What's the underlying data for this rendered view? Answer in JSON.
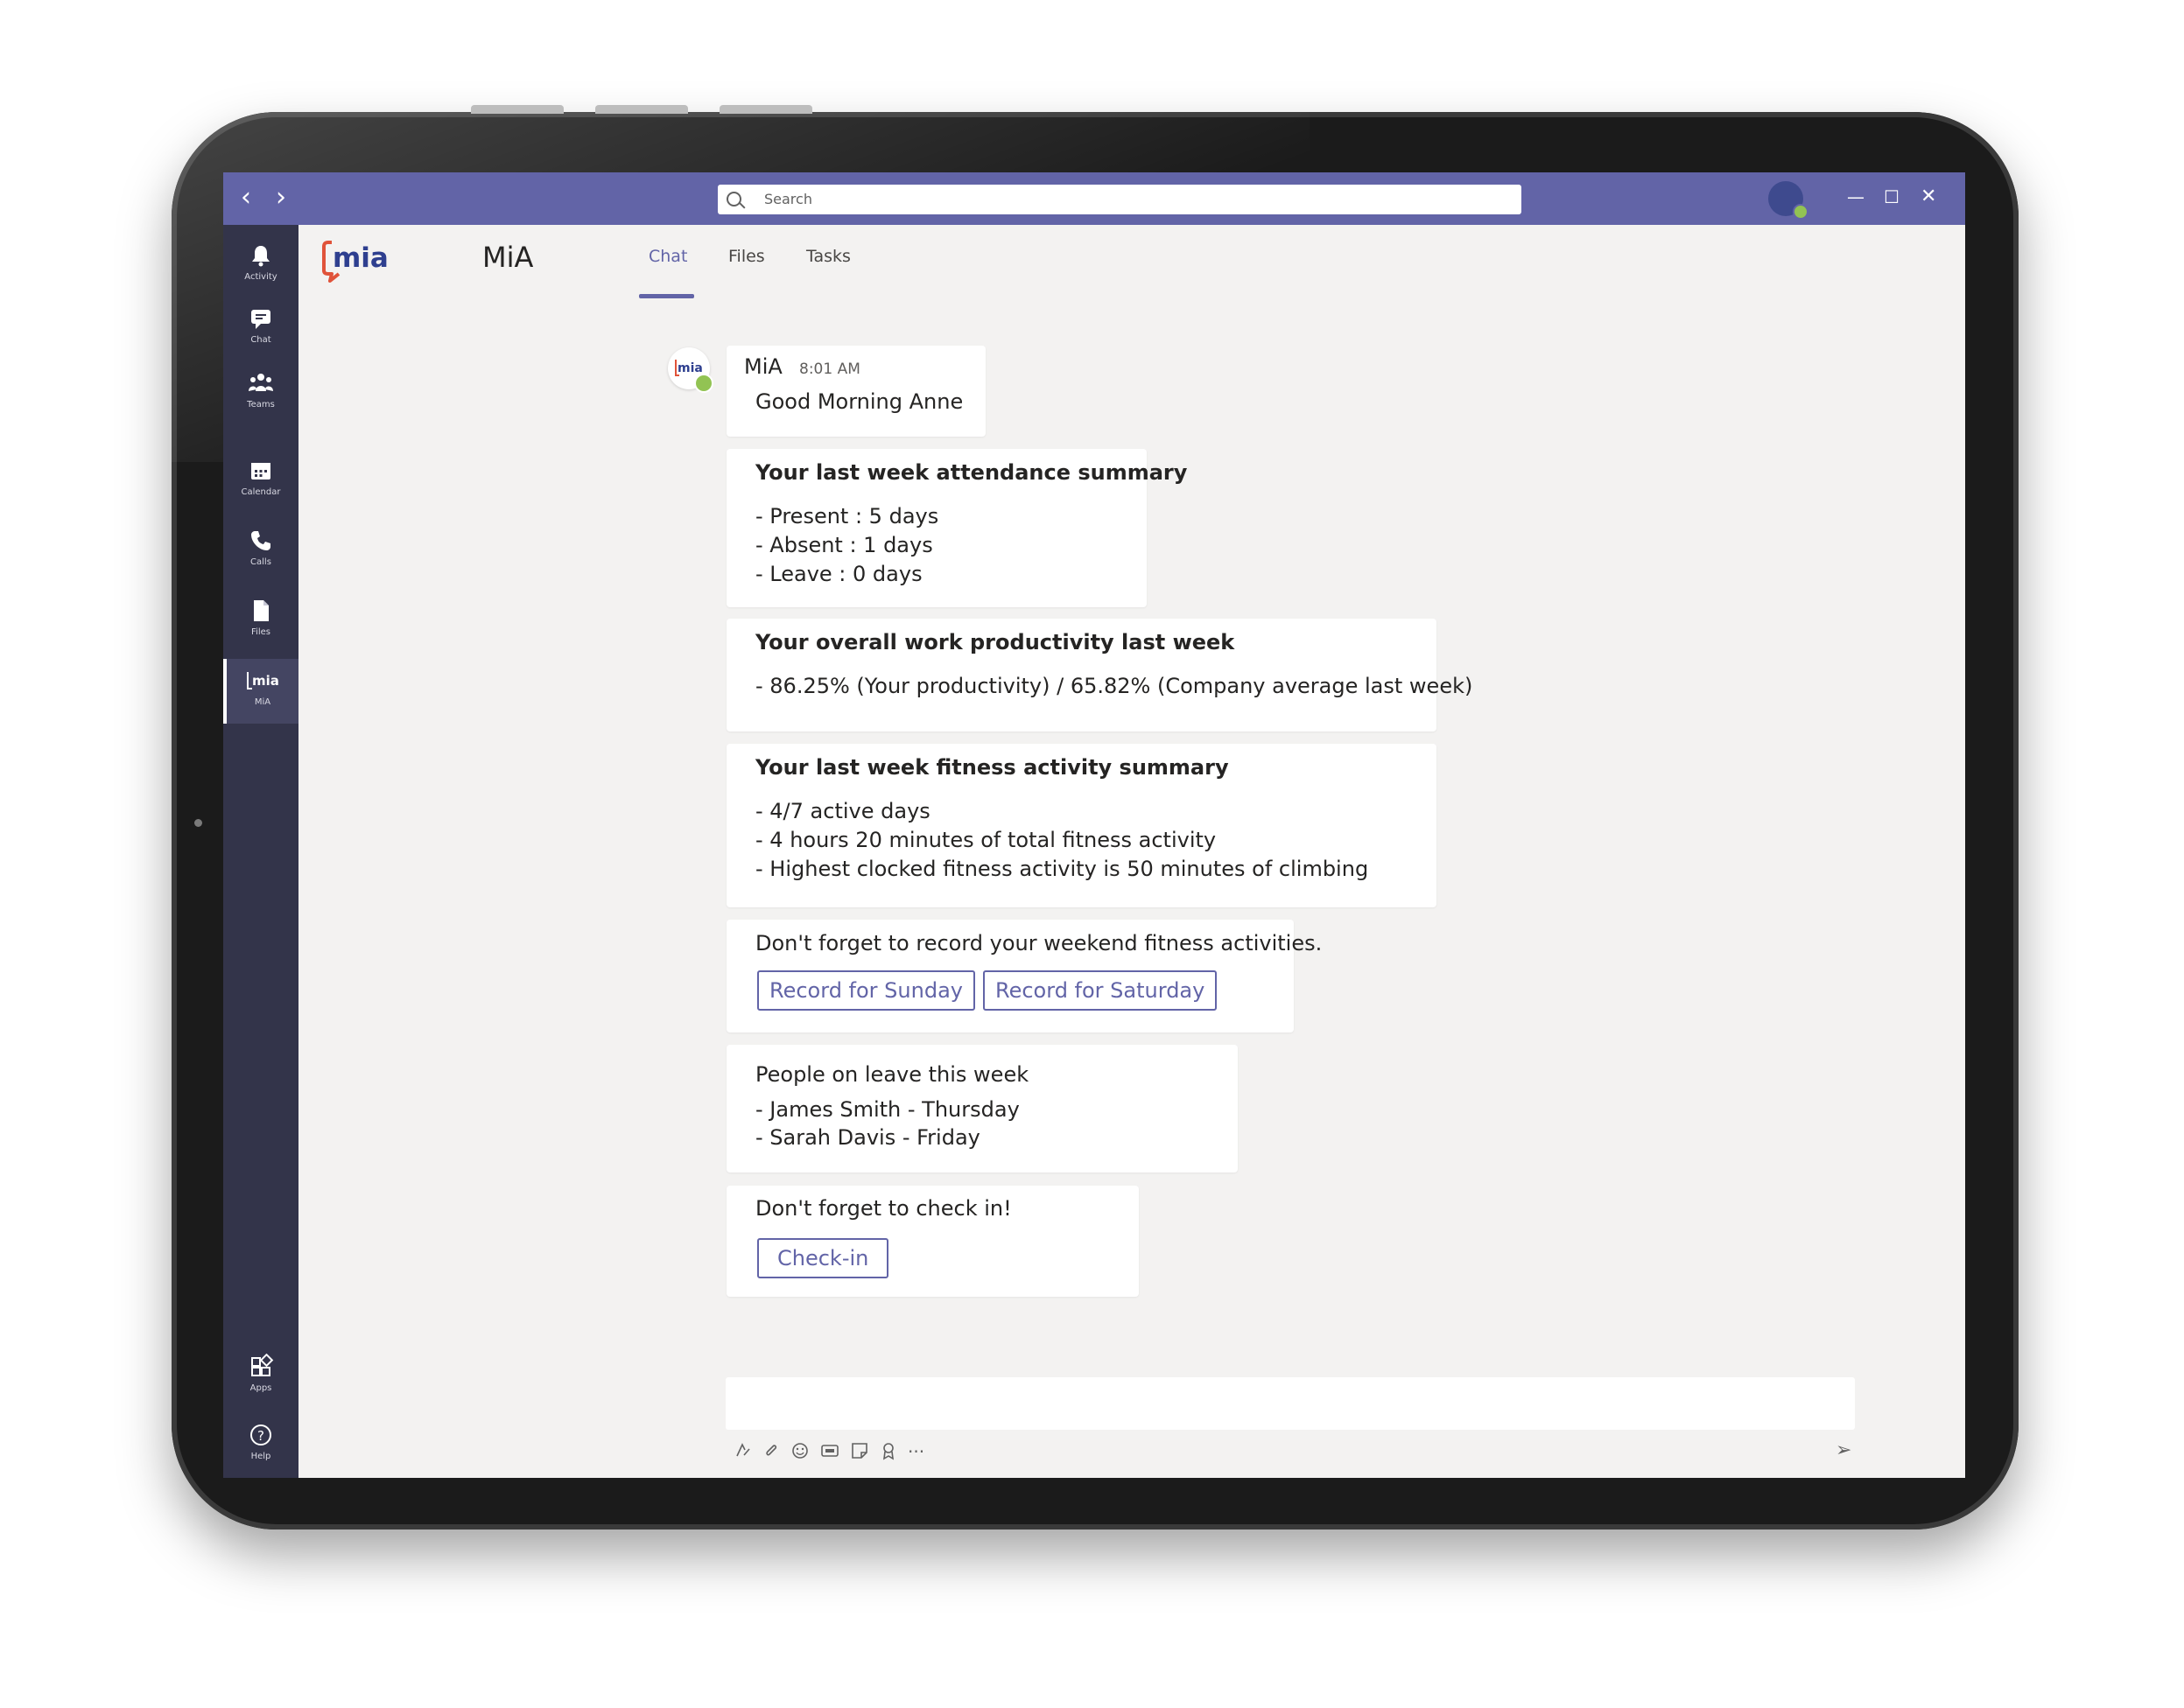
{
  "titlebar": {
    "search_placeholder": "Search",
    "back_glyph": "‹",
    "forward_glyph": "›",
    "minimize_glyph": "—",
    "maximize_glyph": "☐",
    "close_glyph": "✕",
    "accent_color": "#6264a7"
  },
  "rail": {
    "items": [
      {
        "label": "Activity",
        "icon": "bell-icon"
      },
      {
        "label": "Chat",
        "icon": "chat-icon"
      },
      {
        "label": "Teams",
        "icon": "teams-icon"
      },
      {
        "label": "Calendar",
        "icon": "calendar-icon"
      },
      {
        "label": "Calls",
        "icon": "phone-icon"
      },
      {
        "label": "Files",
        "icon": "file-icon"
      },
      {
        "label": "MiA",
        "icon": "mia-icon"
      }
    ],
    "bottom": [
      {
        "label": "Apps",
        "icon": "apps-icon"
      },
      {
        "label": "Help",
        "icon": "help-icon"
      }
    ]
  },
  "app": {
    "logo_text": "mia",
    "name": "MiA",
    "tabs": [
      {
        "label": "Chat",
        "active": true
      },
      {
        "label": "Files",
        "active": false
      },
      {
        "label": "Tasks",
        "active": false
      }
    ]
  },
  "chat": {
    "sender": "MiA",
    "time": "8:01 AM",
    "avatar_text": "mia",
    "greeting": "Good Morning Anne",
    "attendance": {
      "title": "Your last week attendance summary",
      "lines": [
        "- Present : 5 days",
        "- Absent : 1 days",
        "- Leave : 0 days"
      ]
    },
    "productivity": {
      "title": "Your overall work productivity last week",
      "lines": [
        "- 86.25% (Your productivity) / 65.82% (Company average last week)"
      ]
    },
    "fitness": {
      "title": "Your last week fitness activity summary",
      "lines": [
        "- 4/7 active days",
        "- 4 hours 20 minutes of total fitness activity",
        "- Highest clocked fitness activity is 50 minutes of climbing"
      ]
    },
    "reminder": {
      "text": "Don't forget to record your weekend fitness activities.",
      "buttons": [
        "Record for Sunday",
        "Record for Saturday"
      ]
    },
    "leave": {
      "title": "People on leave this week",
      "lines": [
        "- James Smith - Thursday",
        "- Sarah Davis - Friday"
      ]
    },
    "checkin": {
      "text": "Don't forget to check in!",
      "button": "Check-in"
    }
  },
  "composer": {
    "tools": [
      "format-icon",
      "attach-icon",
      "emoji-icon",
      "gif-icon",
      "sticker-icon",
      "praise-icon",
      "more-icon"
    ],
    "more_glyph": "···",
    "send_glyph": "➢"
  }
}
